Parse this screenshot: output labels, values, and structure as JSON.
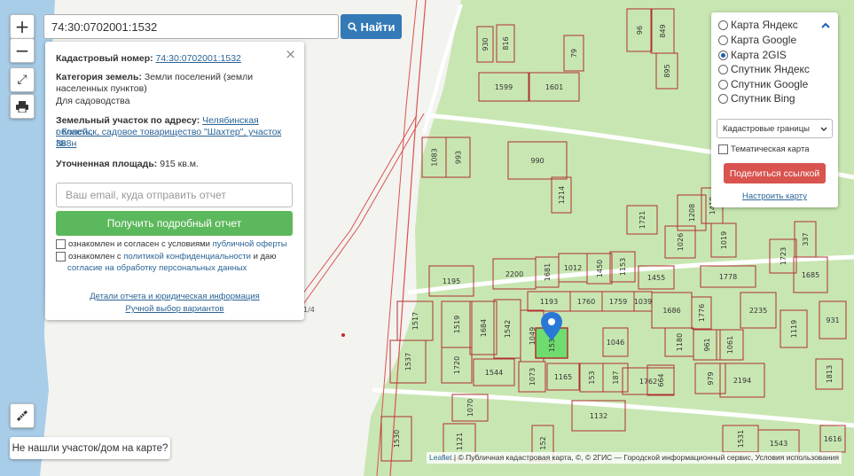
{
  "search": {
    "value": "74:30:0702001:1532",
    "button_label": "Найти"
  },
  "controls": {
    "zoom_in": "+",
    "zoom_out": "−"
  },
  "info": {
    "cad_label": "Кадастровый номер:",
    "cad_value": "74:30:0702001:1532",
    "cat_label": "Категория земель:",
    "cat_value_1": "Земли поселений (земли",
    "cat_value_2": "населенных пунктов)",
    "use": "Для садоводства",
    "addr_label": "Земельный участок по адресу:",
    "addr_1": "Челябинская область,",
    "addr_2": "г Копейск, садовое товарищество \"Шахтер\", участок №",
    "addr_3": "388н",
    "area_label": "Уточненная площадь:",
    "area_value": "915 кв.м.",
    "email_placeholder": "Ваш email, куда отправить отчет",
    "report_button": "Получить подробный отчет",
    "agree1_text": "ознакомлен и согласен с условиями",
    "agree1_link": "публичной оферты",
    "agree2_text": "ознакомлен с",
    "agree2_link1": "политикой конфиденциальности",
    "agree2_mid": "и даю",
    "agree2_link2": "согласие на обработку персональных данных",
    "details_link": "Детали отчета и юридическая информация",
    "manual_link": "Ручной выбор вариантов"
  },
  "layers": {
    "options": [
      "Карта Яндекс",
      "Карта Google",
      "Карта 2GIS",
      "Спутник Яндекс",
      "Спутник Google",
      "Спутник Bing"
    ],
    "selected": "Карта 2GIS",
    "select_value": "Кадастровые границы",
    "thematic_label": "Тематическая карта",
    "share_button": "Поделиться ссылкой",
    "configure_link": "Настроить карту"
  },
  "not_found": "Не нашли участок/дом на карте?",
  "attribution": {
    "leaflet": "Leaflet",
    "text": " | © Публичная кадастровая карта, ©, © 2ГИС — Городской информационный сервис, Условия использования"
  },
  "map_labels": {
    "parcels": [
      "930",
      "816",
      "79",
      "96",
      "849",
      "895",
      "1599",
      "1601",
      "1083",
      "993",
      "990",
      "1214",
      "1721",
      "1026",
      "1208",
      "1418",
      "1019",
      "1723",
      "337",
      "1685",
      "2200",
      "1681",
      "1012",
      "1450",
      "1153",
      "1455",
      "1778",
      "1195",
      "1193",
      "1760",
      "1759",
      "1039",
      "1686",
      "1776",
      "2235",
      "1517",
      "1519",
      "1684",
      "1542",
      "1049",
      "1532",
      "1046",
      "1180",
      "961",
      "1061",
      "1119",
      "931",
      "1537",
      "1720",
      "1544",
      "1073",
      "1165",
      "153",
      "187",
      "1762",
      "664",
      "979",
      "2194",
      "1813",
      "1070",
      "1132",
      "1530",
      "1121",
      "152",
      "1531",
      "1543",
      "1616"
    ],
    "road_label": "1/4"
  },
  "colors": {
    "accent": "#337ab7",
    "success": "#5cb85c",
    "danger": "#d9534f",
    "water": "#a8cde8",
    "land": "#c8e6b2",
    "parcel_border": "#b03030",
    "selected_parcel": "#6fdc6f"
  }
}
